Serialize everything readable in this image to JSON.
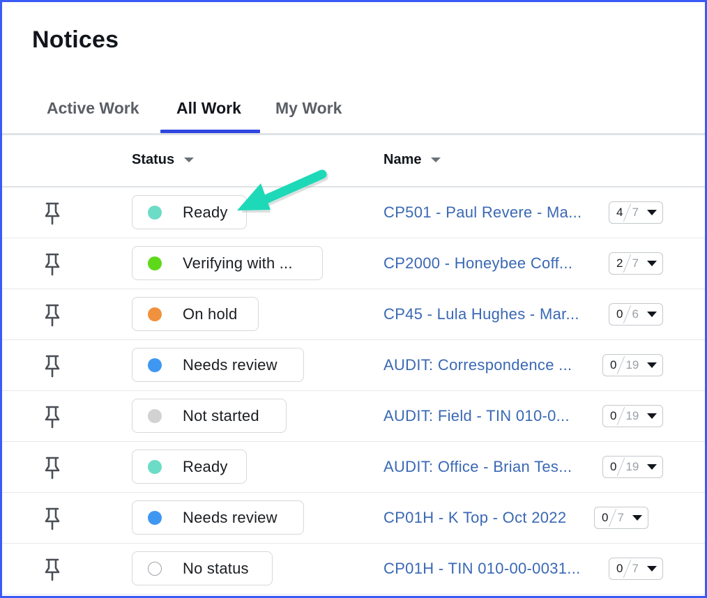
{
  "page": {
    "title": "Notices"
  },
  "tabs": [
    {
      "label": "Active Work",
      "active": false
    },
    {
      "label": "All Work",
      "active": true
    },
    {
      "label": "My Work",
      "active": false
    }
  ],
  "columns": {
    "status": "Status",
    "name": "Name"
  },
  "colors": {
    "accent": "#2f46e0",
    "link": "#3a68b4",
    "annotation_arrow": "#1ed9b8",
    "status_ready": "#6ddcc6",
    "status_verifying": "#5ed91a",
    "status_on_hold": "#f0913e",
    "status_needs_review": "#3f97f2",
    "status_not_started": "#d2d2d2",
    "status_none": "#ffffff"
  },
  "rows": [
    {
      "icon": "pin-icon",
      "status": "Ready",
      "status_color": "#6ddcc6",
      "name": "CP501 - Paul Revere - Ma...",
      "done": "4",
      "total": "7"
    },
    {
      "icon": "pin-icon",
      "status": "Verifying with ...",
      "status_color": "#5ed91a",
      "name": "CP2000 - Honeybee Coff...",
      "done": "2",
      "total": "7"
    },
    {
      "icon": "pin-icon",
      "status": "On hold",
      "status_color": "#f0913e",
      "name": "CP45 - Lula Hughes - Mar...",
      "done": "0",
      "total": "6"
    },
    {
      "icon": "pin-icon",
      "status": "Needs review",
      "status_color": "#3f97f2",
      "name": "AUDIT: Correspondence ...",
      "done": "0",
      "total": "19"
    },
    {
      "icon": "pin-icon",
      "status": "Not started",
      "status_color": "#d2d2d2",
      "name": "AUDIT: Field - TIN 010-0...",
      "done": "0",
      "total": "19"
    },
    {
      "icon": "pin-icon",
      "status": "Ready",
      "status_color": "#6ddcc6",
      "name": "AUDIT: Office - Brian Tes...",
      "done": "0",
      "total": "19"
    },
    {
      "icon": "pin-icon",
      "status": "Needs review",
      "status_color": "#3f97f2",
      "name": "CP01H - K Top - Oct 2022",
      "done": "0",
      "total": "7"
    },
    {
      "icon": "pin-icon",
      "status": "No status",
      "status_color": "#ffffff",
      "name": "CP01H - TIN 010-00-0031...",
      "done": "0",
      "total": "7"
    }
  ]
}
